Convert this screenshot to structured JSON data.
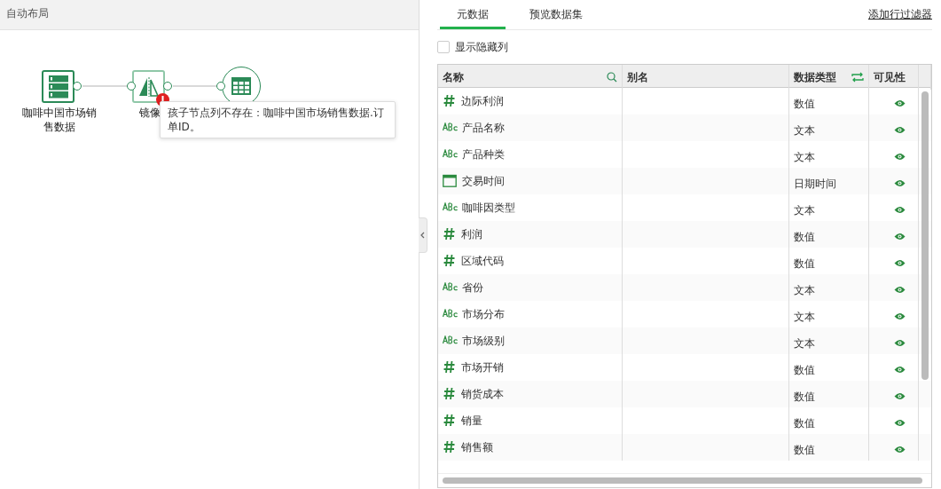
{
  "left_header": {
    "title": "自动布局"
  },
  "flow": {
    "nodes": [
      {
        "kind": "source",
        "label": "咖啡中国市场销售数据",
        "error": false
      },
      {
        "kind": "transform",
        "label": "镜像",
        "error": true
      },
      {
        "kind": "output",
        "error": false
      }
    ],
    "tooltip": "孩子节点列不存在：咖啡中国市场销售数据.订单ID。"
  },
  "tabs": [
    {
      "label": "元数据",
      "selected": true
    },
    {
      "label": "预览数据集",
      "selected": false
    }
  ],
  "add_filter_link": "添加行过滤器",
  "show_hidden": {
    "label": "显示隐藏列",
    "checked": false
  },
  "table": {
    "columns": [
      {
        "label": "名称",
        "kind": "searchable"
      },
      {
        "label": "别名",
        "kind": "plain"
      },
      {
        "label": "数据类型",
        "kind": "switchable"
      },
      {
        "label": "可见性",
        "kind": "plain"
      }
    ],
    "rows": [
      {
        "kind": "number",
        "name": "边际利润",
        "data_type": "数值",
        "visible": true
      },
      {
        "kind": "text",
        "name": "产品名称",
        "data_type": "文本",
        "visible": true
      },
      {
        "kind": "text",
        "name": "产品种类",
        "data_type": "文本",
        "visible": true
      },
      {
        "kind": "datetime",
        "name": "交易时间",
        "data_type": "日期时间",
        "visible": true
      },
      {
        "kind": "text",
        "name": "咖啡因类型",
        "data_type": "文本",
        "visible": true
      },
      {
        "kind": "number",
        "name": "利润",
        "data_type": "数值",
        "visible": true
      },
      {
        "kind": "number",
        "name": "区域代码",
        "data_type": "数值",
        "visible": true
      },
      {
        "kind": "text",
        "name": "省份",
        "data_type": "文本",
        "visible": true
      },
      {
        "kind": "text",
        "name": "市场分布",
        "data_type": "文本",
        "visible": true
      },
      {
        "kind": "text",
        "name": "市场级别",
        "data_type": "文本",
        "visible": true
      },
      {
        "kind": "number",
        "name": "市场开销",
        "data_type": "数值",
        "visible": true
      },
      {
        "kind": "number",
        "name": "销货成本",
        "data_type": "数值",
        "visible": true
      },
      {
        "kind": "number",
        "name": "销量",
        "data_type": "数值",
        "visible": true
      },
      {
        "kind": "number",
        "name": "销售额",
        "data_type": "数值",
        "visible": true
      }
    ]
  }
}
